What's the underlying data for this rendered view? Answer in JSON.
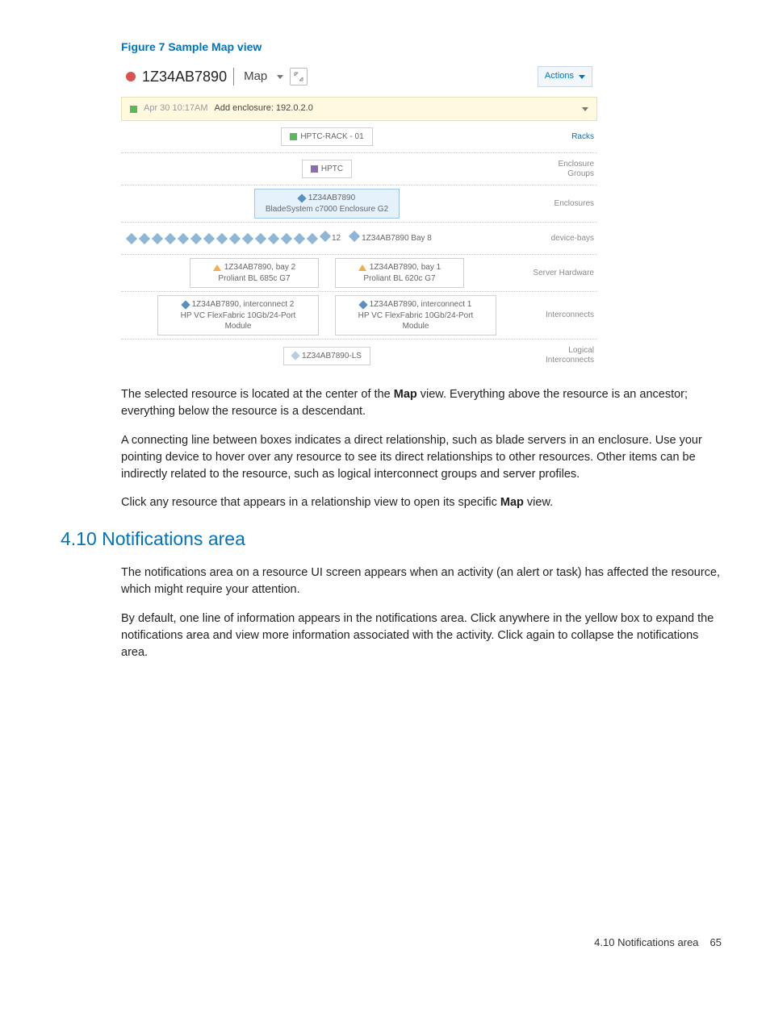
{
  "figure": {
    "caption": "Figure 7 Sample Map view",
    "header": {
      "title": "1Z34AB7890",
      "view": "Map",
      "actions_label": "Actions"
    },
    "notification": {
      "timestamp": "Apr 30 10:17AM",
      "message": "Add enclosure: 192.0.2.0"
    },
    "rows": {
      "racks": {
        "label": "Racks",
        "node": "HPTC-RACK - 01"
      },
      "enclosure_groups": {
        "label": "Enclosure Groups",
        "node": "HPTC"
      },
      "enclosures": {
        "label": "Enclosures",
        "title": "1Z34AB7890",
        "subtitle": "BladeSystem c7000 Enclosure G2"
      },
      "device_bays": {
        "label": "device-bays",
        "count_label": "12",
        "named_bay": "1Z34AB7890 Bay 8"
      },
      "server_hardware": {
        "label": "Server Hardware",
        "left": {
          "title": "1Z34AB7890, bay 2",
          "subtitle": "Proliant BL 685c G7"
        },
        "right": {
          "title": "1Z34AB7890, bay 1",
          "subtitle": "Proliant BL 620c G7"
        }
      },
      "interconnects": {
        "label": "Interconnects",
        "left": {
          "title": "1Z34AB7890, interconnect 2",
          "subtitle": "HP VC FlexFabric 10Gb/24-Port Module"
        },
        "right": {
          "title": "1Z34AB7890, interconnect 1",
          "subtitle": "HP VC FlexFabric 10Gb/24-Port Module"
        }
      },
      "logical_interconnects": {
        "label": "Logical Interconnects",
        "node": "1Z34AB7890-LS"
      }
    }
  },
  "paragraphs": {
    "p1a": "The selected resource is located at the center of the ",
    "p1b": "Map",
    "p1c": " view. Everything above the resource is an ancestor; everything below the resource is a descendant.",
    "p2": "A connecting line between boxes indicates a direct relationship, such as blade servers in an enclosure. Use your pointing device to hover over any resource to see its direct relationships to other resources. Other items can be indirectly related to the resource, such as logical interconnect groups and server profiles.",
    "p3a": "Click any resource that appears in a relationship view to open its specific ",
    "p3b": "Map",
    "p3c": " view."
  },
  "section": {
    "heading": "4.10 Notifications area",
    "p1": "The notifications area on a resource UI screen appears when an activity (an alert or task) has affected the resource, which might require your attention.",
    "p2": "By default, one line of information appears in the notifications area. Click anywhere in the yellow box to expand the notifications area and view more information associated with the activity. Click again to collapse the notifications area."
  },
  "footer": {
    "section_ref": "4.10 Notifications area",
    "page": "65"
  }
}
